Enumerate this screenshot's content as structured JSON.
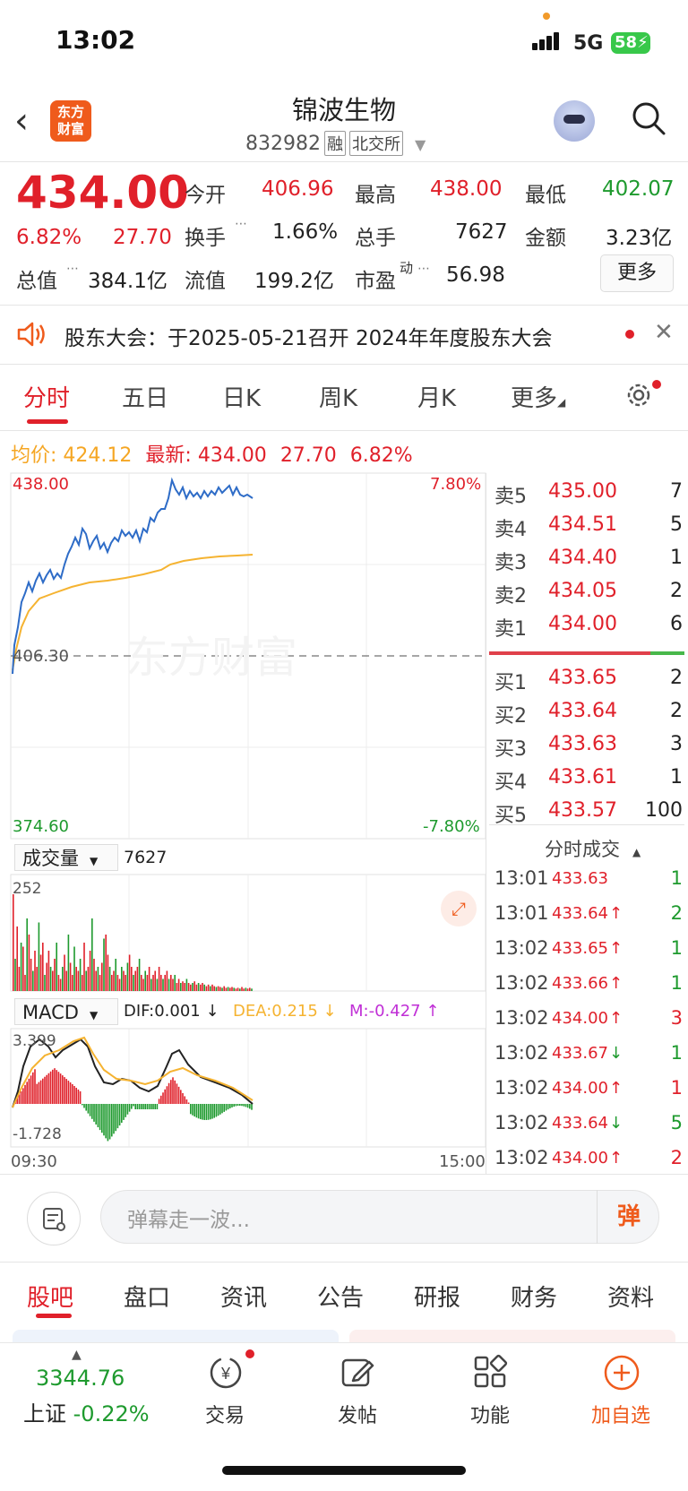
{
  "status": {
    "time": "13:02",
    "network": "5G",
    "battery": "58"
  },
  "header": {
    "logo_text": "东方\n财富",
    "title": "锦波生物",
    "code": "832982",
    "tag1": "融",
    "tag2": "北交所"
  },
  "quote": {
    "price": "434.00",
    "change_pct": "6.82%",
    "change": "27.70",
    "open_label": "今开",
    "open": "406.96",
    "high_label": "最高",
    "high": "438.00",
    "low_label": "最低",
    "low": "402.07",
    "turnover_label": "换手",
    "turnover": "1.66%",
    "volume_label": "总手",
    "volume": "7627",
    "amount_label": "金额",
    "amount": "3.23亿",
    "mktcap_label": "总值",
    "mktcap": "384.1亿",
    "float_label": "流值",
    "float": "199.2亿",
    "pe_label": "市盈",
    "pe_sup": "动",
    "pe": "56.98",
    "more": "更多"
  },
  "notice": {
    "text": "股东大会：于2025-05-21召开 2024年年度股东大会"
  },
  "kline_tabs": [
    "分时",
    "五日",
    "日K",
    "周K",
    "月K",
    "更多"
  ],
  "info": {
    "avg_label": "均价:",
    "avg": "424.12",
    "latest_label": "最新:",
    "latest": "434.00",
    "chg": "27.70",
    "pct": "6.82%"
  },
  "chart": {
    "y_top": "438.00",
    "y_mid": "406.30",
    "y_bottom": "374.60",
    "pct_top": "7.80%",
    "pct_bottom": "-7.80%",
    "vol_label": "成交量",
    "vol_value": "7627",
    "vol_max": "252",
    "macd_label": "MACD",
    "dif": "DIF:0.001 ↓",
    "dea": "DEA:0.215 ↓",
    "m": "M:-0.427 ↑",
    "macd_top": "3.399",
    "macd_bottom": "-1.728",
    "t_start": "09:30",
    "t_end": "15:00",
    "watermark": "东方财富"
  },
  "orderbook": {
    "asks": [
      {
        "label": "卖5",
        "price": "435.00",
        "qty": "7"
      },
      {
        "label": "卖4",
        "price": "434.51",
        "qty": "5"
      },
      {
        "label": "卖3",
        "price": "434.40",
        "qty": "1"
      },
      {
        "label": "卖2",
        "price": "434.05",
        "qty": "2"
      },
      {
        "label": "卖1",
        "price": "434.00",
        "qty": "6"
      }
    ],
    "bids": [
      {
        "label": "买1",
        "price": "433.65",
        "qty": "2"
      },
      {
        "label": "买2",
        "price": "433.64",
        "qty": "2"
      },
      {
        "label": "买3",
        "price": "433.63",
        "qty": "3"
      },
      {
        "label": "买4",
        "price": "433.61",
        "qty": "1"
      },
      {
        "label": "买5",
        "price": "433.57",
        "qty": "100"
      }
    ]
  },
  "ticks_header": "分时成交",
  "ticks": [
    {
      "time": "13:01",
      "price": "433.63",
      "arrow": "",
      "qty": "1",
      "qcolor": "green"
    },
    {
      "time": "13:01",
      "price": "433.64",
      "arrow": "↑",
      "qty": "2",
      "qcolor": "green"
    },
    {
      "time": "13:02",
      "price": "433.65",
      "arrow": "↑",
      "qty": "1",
      "qcolor": "green"
    },
    {
      "time": "13:02",
      "price": "433.66",
      "arrow": "↑",
      "qty": "1",
      "qcolor": "green"
    },
    {
      "time": "13:02",
      "price": "434.00",
      "arrow": "↑",
      "qty": "3",
      "qcolor": "red"
    },
    {
      "time": "13:02",
      "price": "433.67",
      "arrow": "↓",
      "qty": "1",
      "qcolor": "green"
    },
    {
      "time": "13:02",
      "price": "434.00",
      "arrow": "↑",
      "qty": "1",
      "qcolor": "red"
    },
    {
      "time": "13:02",
      "price": "433.64",
      "arrow": "↓",
      "qty": "5",
      "qcolor": "green"
    },
    {
      "time": "13:02",
      "price": "434.00",
      "arrow": "↑",
      "qty": "2",
      "qcolor": "red"
    }
  ],
  "danmu": {
    "placeholder": "弹幕走一波...",
    "button": "弹"
  },
  "bottom_tabs": [
    "股吧",
    "盘口",
    "资讯",
    "公告",
    "研报",
    "财务",
    "资料"
  ],
  "nav": {
    "index_value": "3344.76",
    "index_name": "上证",
    "index_pct": "-0.22%",
    "trade": "交易",
    "post": "发帖",
    "func": "功能",
    "add": "加自选"
  },
  "colors": {
    "red": "#e0202a",
    "green": "#1e9a2e",
    "avg_line": "#f5b331",
    "price_line": "#2e6cc7"
  }
}
